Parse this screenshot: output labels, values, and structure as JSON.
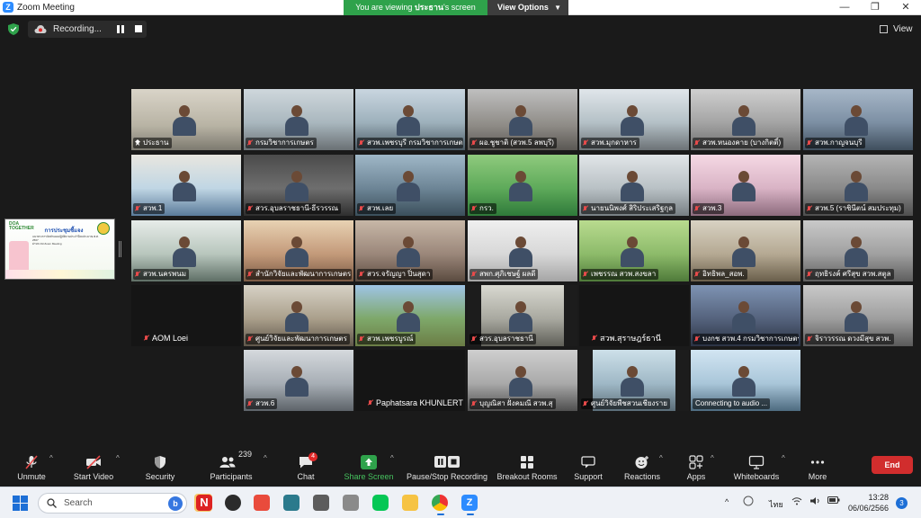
{
  "window": {
    "title": "Zoom Meeting",
    "banner_prefix": "You are viewing",
    "banner_name": "ประธาน",
    "banner_suffix": "'s screen",
    "view_options": "View Options",
    "minimize": "—",
    "maximize": "❐",
    "close": "✕"
  },
  "status": {
    "recording": "Recording...",
    "view_label": "View"
  },
  "shared_screen": {
    "title_top": "DOA TOGETHER",
    "title": "การประชุมชี้แจง",
    "line1": "แนวทางการจัดทำแผนปฏิบัติงานประจำปีงบประมาณ พ.ศ. 2567",
    "line2": "ผ่านระบบ Zoom Meeting"
  },
  "participants_grid": [
    {
      "name": "ประธาน",
      "active": true,
      "muted": false
    },
    {
      "name": "กรมวิชาการเกษตร",
      "muted": true
    },
    {
      "name": "สวพ.เพชรบุรี กรมวิชาการเกษตร",
      "muted": true
    },
    {
      "name": "ผอ.ชูชาติ (สวพ.5 ลพบุรี)",
      "muted": true
    },
    {
      "name": "สวพ.มุกดาหาร",
      "muted": true
    },
    {
      "name": "สวพ.หนองคาย (บางกิตติ์)",
      "muted": true
    },
    {
      "name": "สวพ.กาญจนบุรี",
      "muted": true
    },
    {
      "name": "สวพ.1",
      "muted": true
    },
    {
      "name": "สวร.อุบลราชธานี-ธีรวรรณ",
      "muted": true
    },
    {
      "name": "สวพ.เลย",
      "muted": true
    },
    {
      "name": "กรว.",
      "muted": true
    },
    {
      "name": "นายนนิพงศ์ สิริประเสริฐกุล",
      "muted": true
    },
    {
      "name": "สวพ.3",
      "muted": true
    },
    {
      "name": "สวพ.5 (ราชินีตน์ สมประทุม)",
      "muted": true
    },
    {
      "name": "สวพ.นครพนม",
      "muted": true
    },
    {
      "name": "สำนักวิจัยและพัฒนาการเกษตร",
      "muted": true
    },
    {
      "name": "สวร.จรัญญา ปิ่นสุดา",
      "muted": true
    },
    {
      "name": "สพก.ศุภิเชษฐ์ ผลดี",
      "muted": true
    },
    {
      "name": "เพชรรณ สวพ.สงขลา",
      "muted": true
    },
    {
      "name": "อิทธิพล_สอพ.",
      "muted": true
    },
    {
      "name": "ฤทธิรงค์ ศรีสุข สวพ.สตูล",
      "muted": true
    },
    {
      "name": "AOM Loei",
      "muted": true
    },
    {
      "name": "ศูนย์วิจัยและพัฒนาการเกษตร",
      "muted": true
    },
    {
      "name": "สวพ.เพชรบูรณ์",
      "muted": true
    },
    {
      "name": "สวร.อุบลราชธานี",
      "muted": true
    },
    {
      "name": "สวพ.สุราษฎร์ธานี",
      "muted": true
    },
    {
      "name": "บงกช สวพ.4 กรมวิชาการเกษตร",
      "muted": true
    },
    {
      "name": "จิราวรรณ ดวงมีสุข สวพ.",
      "muted": true
    },
    {
      "name": "สวพ.6",
      "muted": true
    },
    {
      "name": "Paphatsara KHUNLERT",
      "muted": true
    },
    {
      "name": "บุญณิสา ฝั่งคมณี สวพ.สุ",
      "muted": true
    },
    {
      "name": "ศูนย์วิจัยพืชสวนเชียงราย",
      "muted": true
    },
    {
      "name": "Connecting to audio ...",
      "muted": false
    }
  ],
  "toolbar": {
    "unmute": "Unmute",
    "start_video": "Start Video",
    "security": "Security",
    "participants": "Participants",
    "participants_count": "239",
    "chat": "Chat",
    "chat_badge": "4",
    "share_screen": "Share Screen",
    "pause_stop_recording": "Pause/Stop Recording",
    "breakout_rooms": "Breakout Rooms",
    "support": "Support",
    "reactions": "Reactions",
    "apps": "Apps",
    "whiteboards": "Whiteboards",
    "more": "More",
    "end": "End"
  },
  "taskbar": {
    "search_placeholder": "Search",
    "language": "ไทย",
    "time": "13:28",
    "date": "06/06/2566",
    "notifications": "3"
  },
  "colors": {
    "active_speaker": "#d7e34a",
    "banner_green": "#2fa24b",
    "end_red": "#d12d2d",
    "muted_red": "#e84a4a"
  }
}
